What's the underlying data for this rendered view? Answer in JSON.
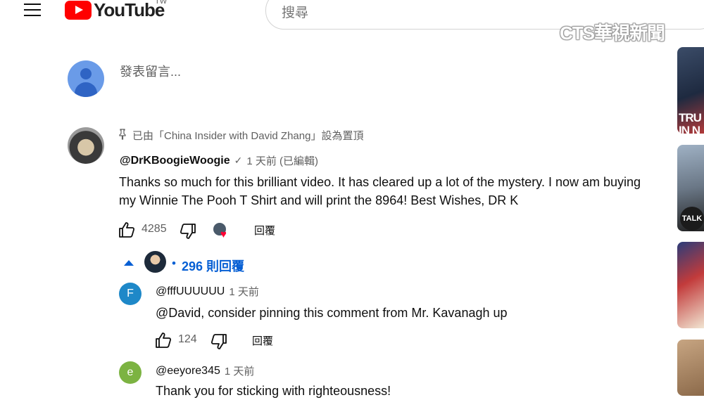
{
  "header": {
    "logo_text": "YouTube",
    "region": "TW",
    "search_placeholder": "搜尋",
    "watermark": "CTS華視新聞"
  },
  "add_comment": {
    "placeholder": "發表留言..."
  },
  "pinned_comment": {
    "pinned_label": "已由「China Insider with David Zhang」設為置頂",
    "author": "@DrKBoogieWoogie",
    "time": "1 天前 (已編輯)",
    "text_line1": "Thanks so much for this brilliant video. It has cleared up a lot of the mystery. I now am buying",
    "text_line2": "my Winnie The Pooh T Shirt and will print the 8964! Best Wishes, DR K",
    "likes": "4285",
    "reply_label": "回覆",
    "replies_count": "296 則回覆",
    "replies_dot": "•"
  },
  "replies": [
    {
      "avatar_letter": "F",
      "avatar_color": "#1e88c8",
      "author": "@fffUUUUUU",
      "time": "1 天前",
      "text": "@David, consider pinning this comment from Mr. Kavanagh up",
      "likes": "124",
      "reply_label": "回覆"
    },
    {
      "avatar_letter": "e",
      "avatar_color": "#7cb342",
      "author": "@eeyore345",
      "time": "1 天前",
      "text": "Thank you for sticking with righteousness!"
    }
  ],
  "sidebar_thumbs": [
    {
      "label": "TRU\nIN N"
    },
    {
      "label": "TALK"
    },
    {
      "label": ""
    },
    {
      "label": ""
    }
  ],
  "colors": {
    "link_blue": "#065fd4",
    "brand_red": "#ff0000",
    "heart_red": "#ff0033"
  }
}
